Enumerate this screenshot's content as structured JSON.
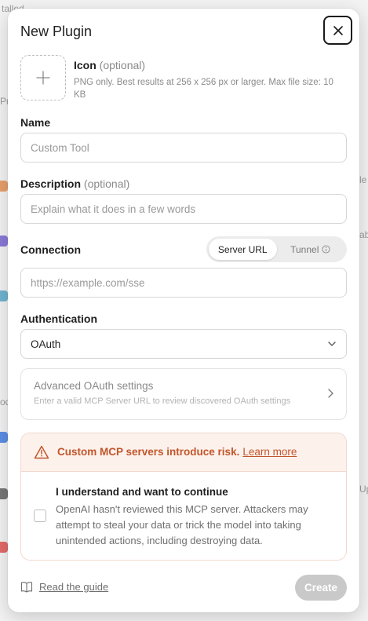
{
  "background": {
    "fragments": [
      "talled",
      "Pu",
      "od",
      "le",
      "ab",
      "Up"
    ]
  },
  "modal": {
    "title": "New Plugin"
  },
  "icon_field": {
    "label": "Icon",
    "optional": "(optional)",
    "hint": "PNG only. Best results at 256 x 256 px or larger. Max file size: 10 KB"
  },
  "name_field": {
    "label": "Name",
    "placeholder": "Custom Tool",
    "value": ""
  },
  "description_field": {
    "label": "Description",
    "optional": "(optional)",
    "placeholder": "Explain what it does in a few words",
    "value": ""
  },
  "connection": {
    "label": "Connection",
    "options": [
      "Server URL",
      "Tunnel"
    ],
    "selected": "Server URL",
    "url_placeholder": "https://example.com/sse",
    "url_value": ""
  },
  "authentication": {
    "label": "Authentication",
    "selected": "OAuth"
  },
  "advanced": {
    "title": "Advanced OAuth settings",
    "subtitle": "Enter a valid MCP Server URL to review discovered OAuth settings"
  },
  "risk": {
    "warning": "Custom MCP servers introduce risk.",
    "link": "Learn more",
    "consent_title": "I understand and want to continue",
    "consent_body": "OpenAI hasn't reviewed this MCP server. Attackers may attempt to steal your data or trick the model into taking unintended actions, including destroying data.",
    "checked": false
  },
  "footer": {
    "guide_label": "Read the guide",
    "create_label": "Create"
  },
  "colors": {
    "warning": "#c2562a",
    "warning_bg": "#fdf1ec",
    "create_disabled": "#c9c9c9"
  },
  "icons": [
    "close-icon",
    "plus-icon",
    "info-icon",
    "chevron-down-icon",
    "chevron-right-icon",
    "warning-icon",
    "book-icon"
  ]
}
